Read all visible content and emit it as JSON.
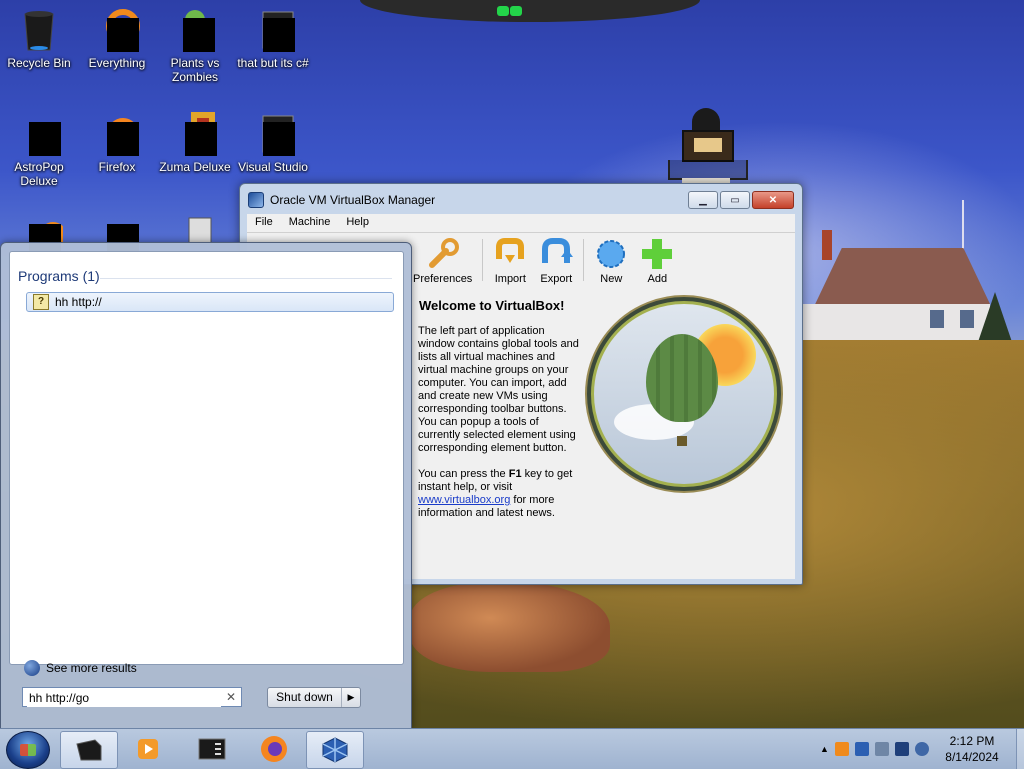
{
  "desktop": {
    "icons": [
      {
        "label": "Recycle Bin"
      },
      {
        "label": "Everything"
      },
      {
        "label": "Plants vs Zombies"
      },
      {
        "label": "that but its c#"
      },
      {
        "label": "AstroPop Deluxe"
      },
      {
        "label": "Firefox"
      },
      {
        "label": "Zuma Deluxe"
      },
      {
        "label": "Visual Studio"
      }
    ]
  },
  "vbox": {
    "title": "Oracle VM VirtualBox Manager",
    "menu": [
      "File",
      "Machine",
      "Help"
    ],
    "toolbar": [
      "Preferences",
      "Import",
      "Export",
      "New",
      "Add"
    ],
    "welcome_title": "Welcome to VirtualBox!",
    "para1": "The left part of application window contains global tools and lists all virtual machines and virtual machine groups on your computer. You can import, add and create new VMs using corresponding toolbar buttons. You can popup a tools of currently selected element using corresponding element button.",
    "para2_prefix": "You can press the ",
    "para2_key": "F1",
    "para2_mid": " key to get instant help, or visit ",
    "link": "www.virtualbox.org",
    "para2_suffix": " for more information and latest news."
  },
  "start_menu": {
    "programs_heading": "Programs (1)",
    "result": "hh http://",
    "see_more": "See more results",
    "search_value": "hh http://go",
    "shutdown_label": "Shut down"
  },
  "taskbar": {
    "time": "2:12 PM",
    "date": "8/14/2024"
  },
  "colors": {
    "accent": "#1e3a78",
    "link": "#1a3cc9",
    "close_button": "#c4412a"
  }
}
